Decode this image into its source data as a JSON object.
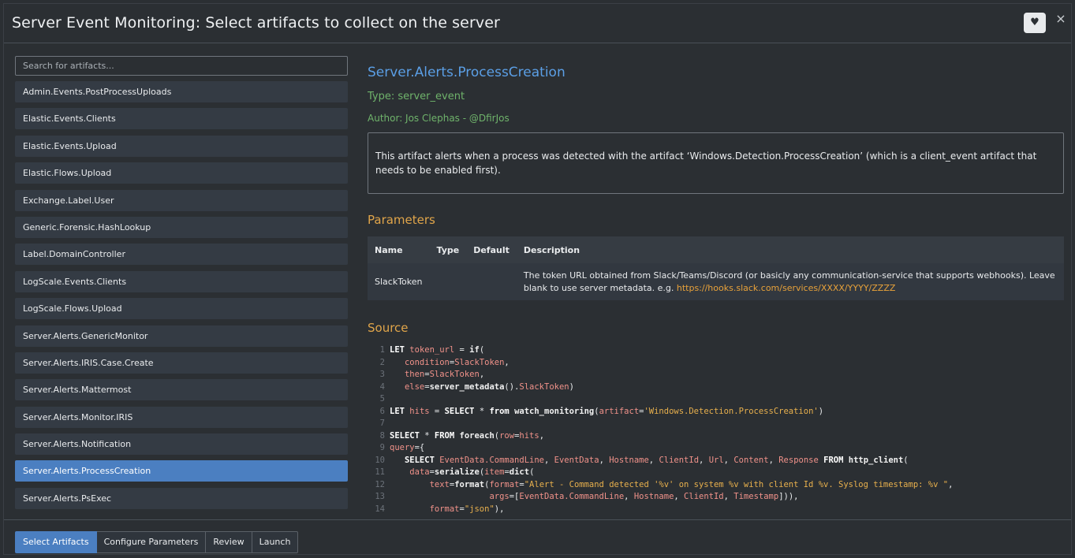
{
  "header": {
    "title": "Server Event Monitoring: Select artifacts to collect on the server",
    "favorite_icon": "heart-icon",
    "close_icon": "close-icon",
    "close_glyph": "×",
    "heart_glyph": "♥"
  },
  "search": {
    "placeholder": "Search for artifacts..."
  },
  "artifacts": [
    "Admin.Events.PostProcessUploads",
    "Elastic.Events.Clients",
    "Elastic.Events.Upload",
    "Elastic.Flows.Upload",
    "Exchange.Label.User",
    "Generic.Forensic.HashLookup",
    "Label.DomainController",
    "LogScale.Events.Clients",
    "LogScale.Flows.Upload",
    "Server.Alerts.GenericMonitor",
    "Server.Alerts.IRIS.Case.Create",
    "Server.Alerts.Mattermost",
    "Server.Alerts.Monitor.IRIS",
    "Server.Alerts.Notification",
    "Server.Alerts.ProcessCreation",
    "Server.Alerts.PsExec"
  ],
  "selected_artifact": "Server.Alerts.ProcessCreation",
  "detail": {
    "name": "Server.Alerts.ProcessCreation",
    "type": "Type: server_event",
    "author": "Author: Jos Clephas - @DfirJos",
    "description": "This artifact alerts when a process was detected with the artifact ‘Windows.Detection.ProcessCreation’ (which is a client_event artifact that needs to be enabled first).",
    "parameters_heading": "Parameters",
    "source_heading": "Source",
    "param_columns": {
      "name": "Name",
      "type": "Type",
      "default": "Default",
      "description": "Description"
    },
    "param_row": {
      "name": "SlackToken",
      "type": "",
      "default": "",
      "description": "The token URL obtained from Slack/Teams/Discord (or basicly any communication-service that supports webhooks). Leave blank to use server metadata. e.g. ",
      "link": "https://hooks.slack.com/services/XXXX/YYYY/ZZZZ"
    }
  },
  "source_lines": [
    [
      [
        "kw",
        "LET "
      ],
      [
        "var",
        "token_url"
      ],
      [
        "txt",
        " = "
      ],
      [
        "fn",
        "if"
      ],
      [
        "txt",
        "("
      ]
    ],
    [
      [
        "txt",
        "   "
      ],
      [
        "var",
        "condition"
      ],
      [
        "txt",
        "="
      ],
      [
        "var",
        "SlackToken"
      ],
      [
        "txt",
        ","
      ]
    ],
    [
      [
        "txt",
        "   "
      ],
      [
        "var",
        "then"
      ],
      [
        "txt",
        "="
      ],
      [
        "var",
        "SlackToken"
      ],
      [
        "txt",
        ","
      ]
    ],
    [
      [
        "txt",
        "   "
      ],
      [
        "var",
        "else"
      ],
      [
        "txt",
        "="
      ],
      [
        "fn",
        "server_metadata"
      ],
      [
        "txt",
        "()."
      ],
      [
        "var",
        "SlackToken"
      ],
      [
        "txt",
        ")"
      ]
    ],
    [],
    [
      [
        "kw",
        "LET "
      ],
      [
        "var",
        "hits"
      ],
      [
        "txt",
        " = "
      ],
      [
        "kw",
        "SELECT"
      ],
      [
        "txt",
        " * "
      ],
      [
        "kw",
        "from "
      ],
      [
        "fn",
        "watch_monitoring"
      ],
      [
        "txt",
        "("
      ],
      [
        "var",
        "artifact"
      ],
      [
        "txt",
        "="
      ],
      [
        "str",
        "'Windows.Detection.ProcessCreation'"
      ],
      [
        "txt",
        ")"
      ]
    ],
    [],
    [
      [
        "kw",
        "SELECT"
      ],
      [
        "txt",
        " * "
      ],
      [
        "kw",
        "FROM "
      ],
      [
        "fn",
        "foreach"
      ],
      [
        "txt",
        "("
      ],
      [
        "var",
        "row"
      ],
      [
        "txt",
        "="
      ],
      [
        "var",
        "hits"
      ],
      [
        "txt",
        ","
      ]
    ],
    [
      [
        "var",
        "query"
      ],
      [
        "txt",
        "={"
      ]
    ],
    [
      [
        "txt",
        "   "
      ],
      [
        "kw",
        "SELECT "
      ],
      [
        "var",
        "EventData.CommandLine"
      ],
      [
        "txt",
        ", "
      ],
      [
        "var",
        "EventData"
      ],
      [
        "txt",
        ", "
      ],
      [
        "var",
        "Hostname"
      ],
      [
        "txt",
        ", "
      ],
      [
        "var",
        "ClientId"
      ],
      [
        "txt",
        ", "
      ],
      [
        "var",
        "Url"
      ],
      [
        "txt",
        ", "
      ],
      [
        "var",
        "Content"
      ],
      [
        "txt",
        ", "
      ],
      [
        "var",
        "Response"
      ],
      [
        "txt",
        " "
      ],
      [
        "kw",
        "FROM "
      ],
      [
        "fn",
        "http_client"
      ],
      [
        "txt",
        "("
      ]
    ],
    [
      [
        "txt",
        "    "
      ],
      [
        "var",
        "data"
      ],
      [
        "txt",
        "="
      ],
      [
        "fn",
        "serialize"
      ],
      [
        "txt",
        "("
      ],
      [
        "var",
        "item"
      ],
      [
        "txt",
        "="
      ],
      [
        "fn",
        "dict"
      ],
      [
        "txt",
        "("
      ]
    ],
    [
      [
        "txt",
        "        "
      ],
      [
        "var",
        "text"
      ],
      [
        "txt",
        "="
      ],
      [
        "fn",
        "format"
      ],
      [
        "txt",
        "("
      ],
      [
        "var",
        "format"
      ],
      [
        "txt",
        "="
      ],
      [
        "str",
        "\"Alert - Command detected '%v' on system %v with client Id %v. Syslog timestamp: %v \""
      ],
      [
        "txt",
        ","
      ]
    ],
    [
      [
        "txt",
        "                    "
      ],
      [
        "var",
        "args"
      ],
      [
        "txt",
        "=["
      ],
      [
        "var",
        "EventData.CommandLine"
      ],
      [
        "txt",
        ", "
      ],
      [
        "var",
        "Hostname"
      ],
      [
        "txt",
        ", "
      ],
      [
        "var",
        "ClientId"
      ],
      [
        "txt",
        ", "
      ],
      [
        "var",
        "Timestamp"
      ],
      [
        "txt",
        "])),"
      ]
    ],
    [
      [
        "txt",
        "        "
      ],
      [
        "var",
        "format"
      ],
      [
        "txt",
        "="
      ],
      [
        "str",
        "\"json\""
      ],
      [
        "txt",
        "),"
      ]
    ]
  ],
  "footer": {
    "steps": [
      "Select Artifacts",
      "Configure Parameters",
      "Review",
      "Launch"
    ],
    "active_step": "Select Artifacts"
  }
}
